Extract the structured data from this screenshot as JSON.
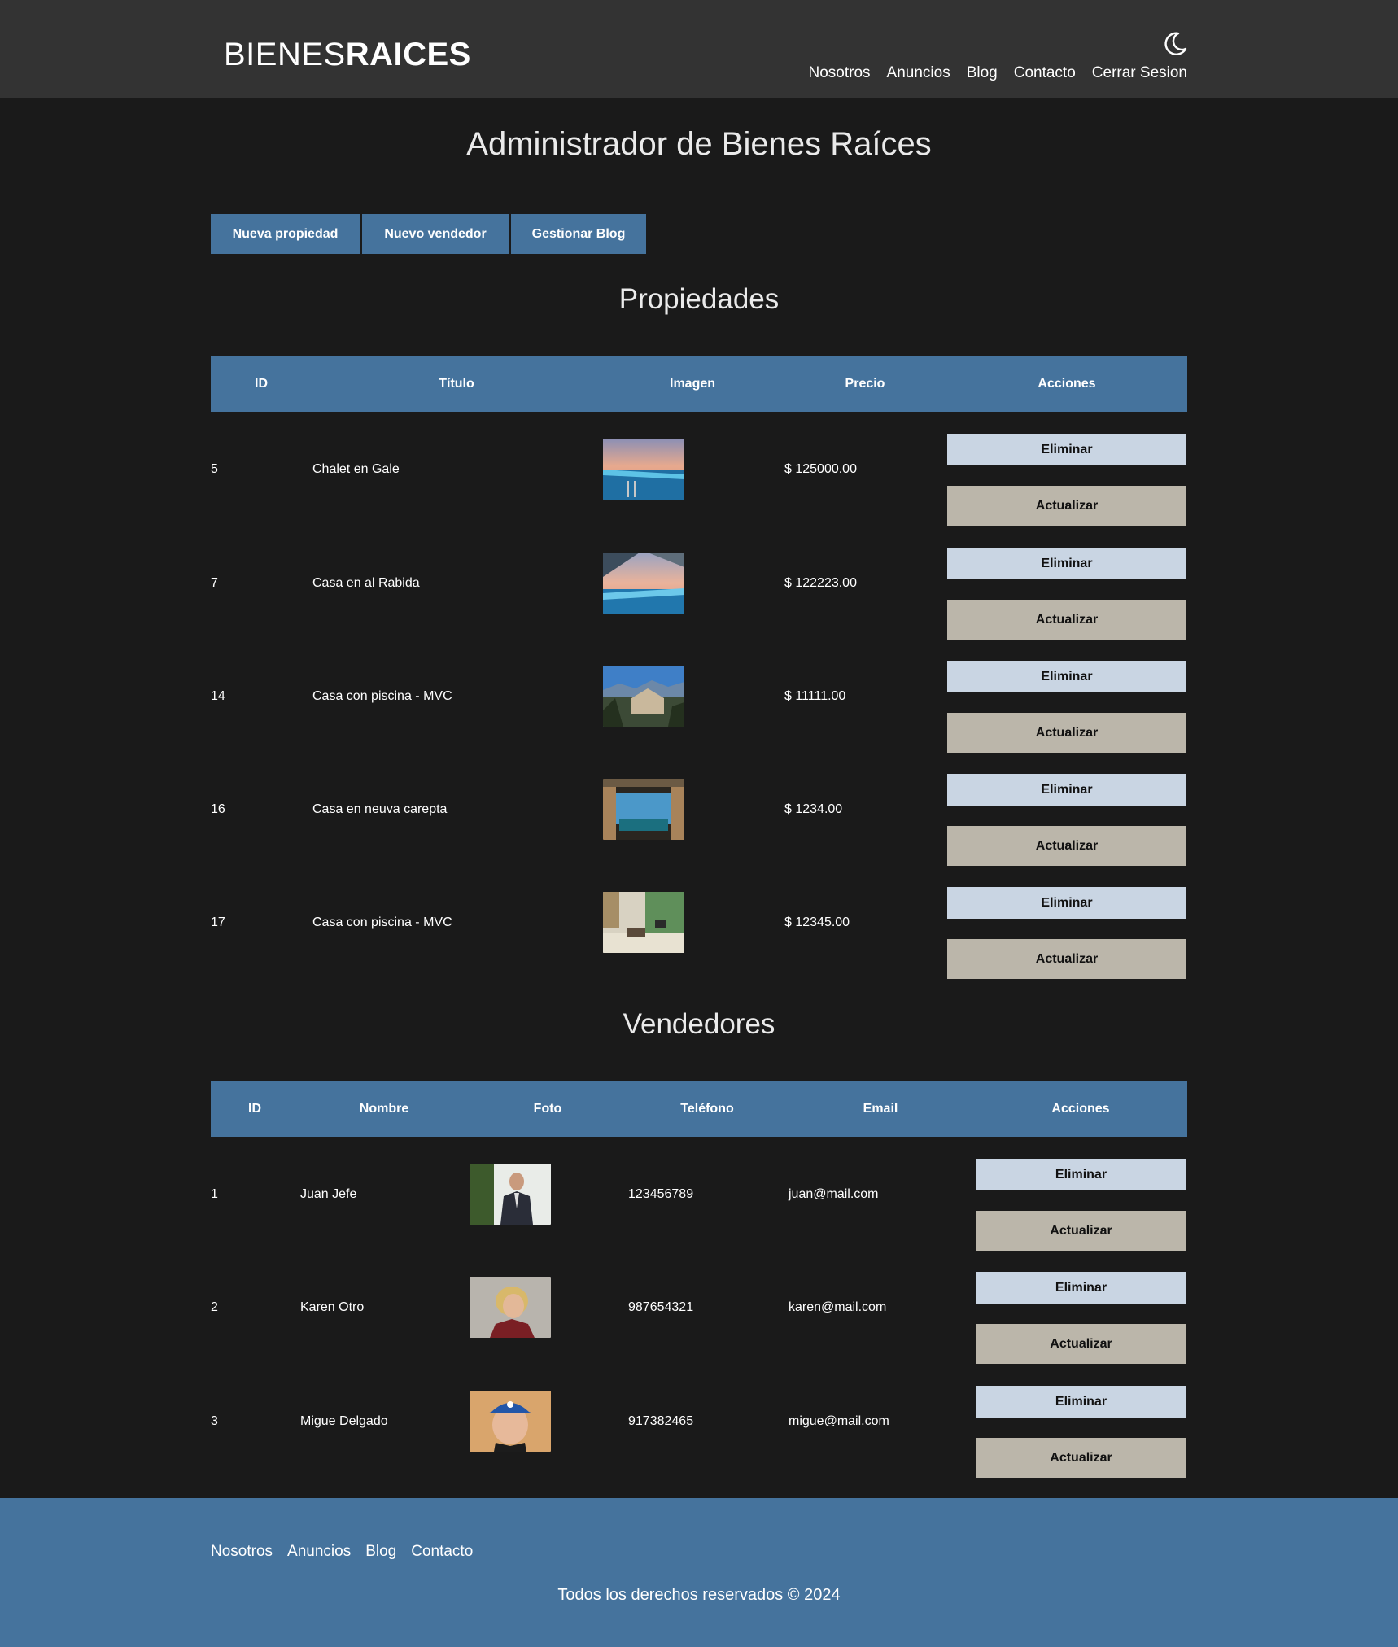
{
  "header": {
    "logo_light": "BIENES",
    "logo_bold": "RAICES",
    "nav": [
      "Nosotros",
      "Anuncios",
      "Blog",
      "Contacto",
      "Cerrar Sesion"
    ]
  },
  "main": {
    "title": "Administrador de Bienes Raíces",
    "buttons": [
      "Nueva propiedad",
      "Nuevo vendedor",
      "Gestionar Blog"
    ]
  },
  "properties": {
    "title": "Propiedades",
    "headers": [
      "ID",
      "Título",
      "Imagen",
      "Precio",
      "Acciones"
    ],
    "rows": [
      {
        "id": "5",
        "titulo": "Chalet en Gale",
        "precio": "$ 125000.00"
      },
      {
        "id": "7",
        "titulo": "Casa en al Rabida",
        "precio": "$ 122223.00"
      },
      {
        "id": "14",
        "titulo": "Casa con piscina - MVC",
        "precio": "$ 11111.00"
      },
      {
        "id": "16",
        "titulo": "Casa en neuva carepta",
        "precio": "$ 1234.00"
      },
      {
        "id": "17",
        "titulo": "Casa con piscina - MVC",
        "precio": "$ 12345.00"
      }
    ],
    "delete_label": "Eliminar",
    "update_label": "Actualizar"
  },
  "sellers": {
    "title": "Vendedores",
    "headers": [
      "ID",
      "Nombre",
      "Foto",
      "Teléfono",
      "Email",
      "Acciones"
    ],
    "rows": [
      {
        "id": "1",
        "nombre": "Juan Jefe",
        "telefono": "123456789",
        "email": "juan@mail.com"
      },
      {
        "id": "2",
        "nombre": "Karen Otro",
        "telefono": "987654321",
        "email": "karen@mail.com"
      },
      {
        "id": "3",
        "nombre": "Migue Delgado",
        "telefono": "917382465",
        "email": "migue@mail.com"
      }
    ],
    "delete_label": "Eliminar",
    "update_label": "Actualizar"
  },
  "footer": {
    "nav": [
      "Nosotros",
      "Anuncios",
      "Blog",
      "Contacto"
    ],
    "copyright": "Todos los derechos reservados © 2024"
  },
  "colors": {
    "header_bg": "#333333",
    "page_bg": "#1a1a1a",
    "accent": "#45739d",
    "delete_button": "#c9d5e3",
    "update_button": "#bbb6aa"
  },
  "icons": {
    "theme_toggle": "moon-icon"
  }
}
